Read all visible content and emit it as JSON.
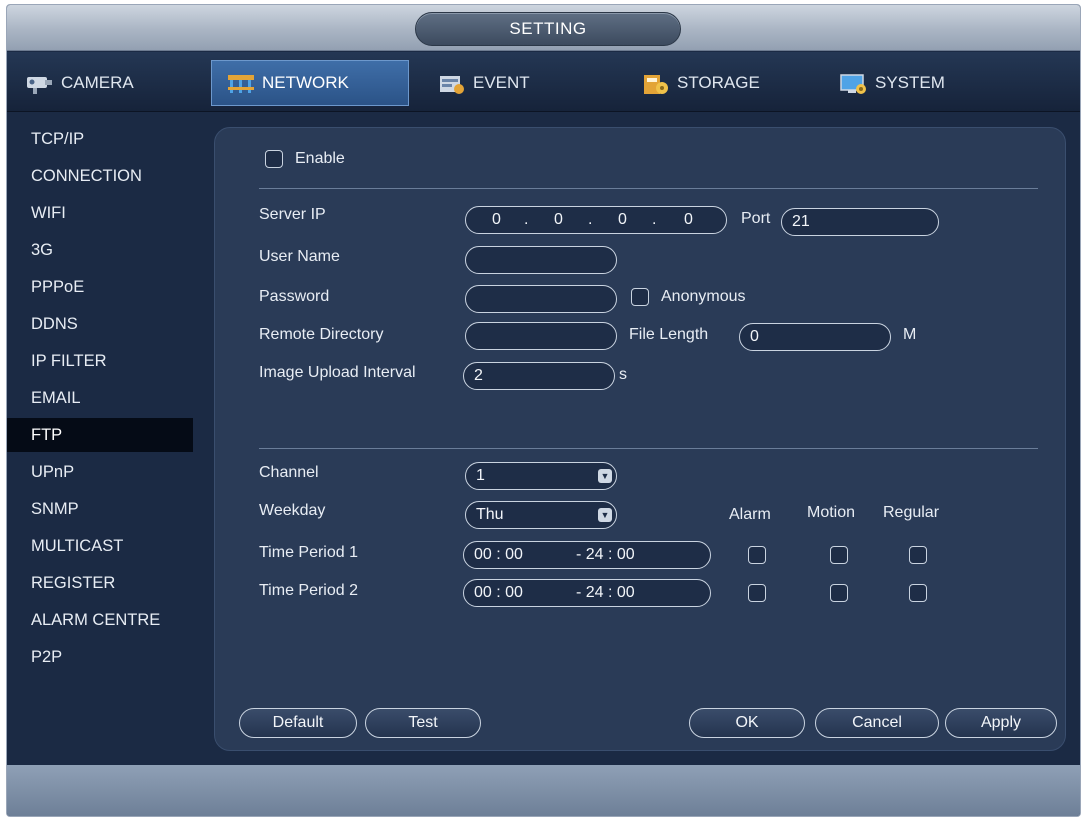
{
  "window": {
    "title": "SETTING"
  },
  "tabs": [
    {
      "label": "CAMERA",
      "icon": "camera-icon",
      "active": false
    },
    {
      "label": "NETWORK",
      "icon": "network-icon",
      "active": true
    },
    {
      "label": "EVENT",
      "icon": "event-icon",
      "active": false
    },
    {
      "label": "STORAGE",
      "icon": "storage-icon",
      "active": false
    },
    {
      "label": "SYSTEM",
      "icon": "system-icon",
      "active": false
    }
  ],
  "sidebar": {
    "items": [
      {
        "label": "TCP/IP"
      },
      {
        "label": "CONNECTION"
      },
      {
        "label": "WIFI"
      },
      {
        "label": "3G"
      },
      {
        "label": "PPPoE"
      },
      {
        "label": "DDNS"
      },
      {
        "label": "IP FILTER"
      },
      {
        "label": "EMAIL"
      },
      {
        "label": "FTP",
        "active": true
      },
      {
        "label": "UPnP"
      },
      {
        "label": "SNMP"
      },
      {
        "label": "MULTICAST"
      },
      {
        "label": "REGISTER"
      },
      {
        "label": "ALARM CENTRE"
      },
      {
        "label": "P2P"
      }
    ]
  },
  "ftp": {
    "enable_label": "Enable",
    "enable_checked": false,
    "server_ip_label": "Server IP",
    "server_ip": [
      "0",
      "0",
      "0",
      "0"
    ],
    "port_label": "Port",
    "port_value": "21",
    "user_name_label": "User Name",
    "user_name_value": "",
    "password_label": "Password",
    "password_value": "",
    "anonymous_label": "Anonymous",
    "anonymous_checked": false,
    "remote_directory_label": "Remote Directory",
    "remote_directory_value": "",
    "file_length_label": "File Length",
    "file_length_value": "0",
    "file_length_unit": "M",
    "interval_label": "Image Upload Interval",
    "interval_value": "2",
    "interval_unit": "s"
  },
  "schedule": {
    "channel_label": "Channel",
    "channel_value": "1",
    "weekday_label": "Weekday",
    "weekday_value": "Thu",
    "columns": [
      "Alarm",
      "Motion",
      "Regular"
    ],
    "periods": [
      {
        "label": "Time Period 1",
        "start": "00 : 00",
        "end": "- 24 : 00",
        "alarm": false,
        "motion": false,
        "regular": false
      },
      {
        "label": "Time Period 2",
        "start": "00 : 00",
        "end": "- 24 : 00",
        "alarm": false,
        "motion": false,
        "regular": false
      }
    ]
  },
  "buttons": {
    "default": "Default",
    "test": "Test",
    "ok": "OK",
    "cancel": "Cancel",
    "apply": "Apply"
  },
  "colors": {
    "active_tab": "#3f6ea8",
    "panel": "#2a3b57",
    "background": "#1b2a44",
    "sidebar_active": "#050b16"
  }
}
